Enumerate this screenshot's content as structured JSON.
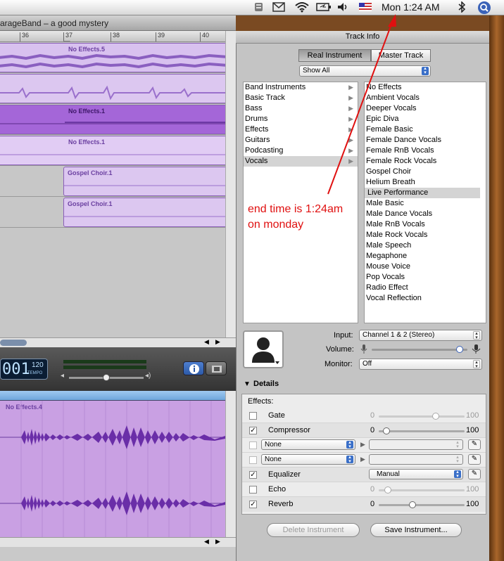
{
  "menubar": {
    "clock": "Mon 1:24 AM",
    "icons": [
      "script-icon",
      "mail-icon",
      "wifi-icon",
      "battery-icon",
      "volume-icon",
      "flag-icon",
      "bluetooth-icon",
      "spotlight-icon"
    ]
  },
  "window": {
    "title": "arageBand – a good mystery"
  },
  "ruler": {
    "ticks": [
      "36",
      "37",
      "38",
      "39",
      "40"
    ]
  },
  "tracks": {
    "regions": [
      {
        "label": "No Effects.5"
      },
      {
        "label": ""
      },
      {
        "label": "No Effects.1"
      },
      {
        "label": "No Effects.1"
      },
      {
        "label": "Gospel Choir.1"
      },
      {
        "label": "Gospel Choir.1"
      }
    ]
  },
  "transport": {
    "lcd_time": "001",
    "lcd_tempo": "120",
    "lcd_tempo_label": "TEMPO"
  },
  "editor": {
    "region_label": "No Effects.4"
  },
  "track_info": {
    "header": "Track Info",
    "tabs": {
      "real": "Real Instrument",
      "master": "Master Track"
    },
    "filter": "Show All",
    "categories": [
      "Band Instruments",
      "Basic Track",
      "Bass",
      "Drums",
      "Effects",
      "Guitars",
      "Podcasting",
      "Vocals"
    ],
    "selected_category": "Vocals",
    "presets": [
      "No Effects",
      "Ambient Vocals",
      "Deeper Vocals",
      "Epic Diva",
      "Female Basic",
      "Female Dance Vocals",
      "Female RnB Vocals",
      "Female Rock Vocals",
      "Gospel Choir",
      "Helium Breath",
      "Live Performance",
      "Male Basic",
      "Male Dance Vocals",
      "Male RnB Vocals",
      "Male Rock Vocals",
      "Male Speech",
      "Megaphone",
      "Mouse Voice",
      "Pop Vocals",
      "Radio Effect",
      "Vocal Reflection"
    ],
    "selected_preset": "Live Performance",
    "input_label": "Input:",
    "input_value": "Channel 1 & 2 (Stereo)",
    "volume_label": "Volume:",
    "volume_level": 0.95,
    "monitor_label": "Monitor:",
    "monitor_value": "Off",
    "details_label": "Details",
    "effects_label": "Effects:",
    "effects": {
      "gate": {
        "name": "Gate",
        "min": "0",
        "max": "100",
        "checked": false,
        "level": 0.68
      },
      "compressor": {
        "name": "Compressor",
        "min": "0",
        "max": "100",
        "checked": true,
        "level": 0.05
      },
      "slot1": {
        "value": "None"
      },
      "slot2": {
        "value": "None"
      },
      "equalizer": {
        "name": "Equalizer",
        "preset": "Manual",
        "checked": true
      },
      "echo": {
        "name": "Echo",
        "min": "0",
        "max": "100",
        "checked": false,
        "level": 0.07
      },
      "reverb": {
        "name": "Reverb",
        "min": "0",
        "max": "100",
        "checked": true,
        "level": 0.38
      }
    },
    "delete_button": "Delete Instrument",
    "save_button": "Save Instrument..."
  },
  "annotation": {
    "line1": "end time is 1:24am",
    "line2": "on monday"
  },
  "colors": {
    "annotation": "#e01010",
    "region_purple": "#b98ce0",
    "selected_region": "#a465d8"
  }
}
